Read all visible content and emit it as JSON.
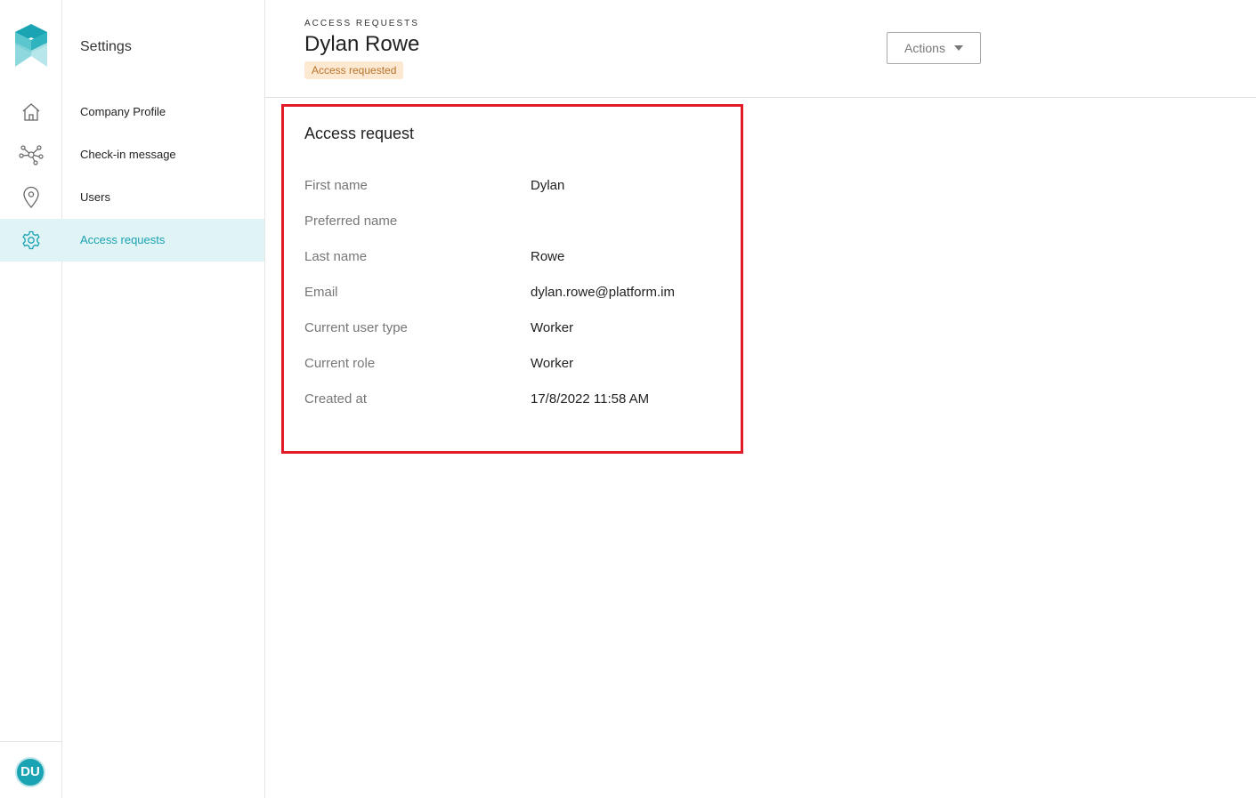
{
  "rail": {
    "items": [
      {
        "name": "home",
        "icon": "home-icon"
      },
      {
        "name": "network",
        "icon": "network-icon"
      },
      {
        "name": "locations",
        "icon": "location-pin-icon"
      },
      {
        "name": "settings",
        "icon": "gear-icon",
        "active": true
      }
    ],
    "avatar_initials": "DU"
  },
  "sidebar": {
    "title": "Settings",
    "items": [
      {
        "label": "Company Profile"
      },
      {
        "label": "Check-in message"
      },
      {
        "label": "Users"
      },
      {
        "label": "Access requests",
        "active": true
      }
    ]
  },
  "header": {
    "breadcrumb": "ACCESS REQUESTS",
    "title": "Dylan Rowe",
    "status": "Access requested",
    "actions_label": "Actions"
  },
  "card": {
    "title": "Access request",
    "rows": [
      {
        "label": "First name",
        "value": "Dylan"
      },
      {
        "label": "Preferred name",
        "value": ""
      },
      {
        "label": "Last name",
        "value": "Rowe"
      },
      {
        "label": "Email",
        "value": "dylan.rowe@platform.im"
      },
      {
        "label": "Current user type",
        "value": "Worker"
      },
      {
        "label": "Current role",
        "value": "Worker"
      },
      {
        "label": "Created at",
        "value": "17/8/2022 11:58 AM"
      }
    ]
  },
  "colors": {
    "accent": "#1aa3b3",
    "active_bg": "#e0f3f5",
    "badge_bg": "#fde8d2",
    "badge_text": "#b8732a",
    "highlight_border": "#e21b2b"
  }
}
